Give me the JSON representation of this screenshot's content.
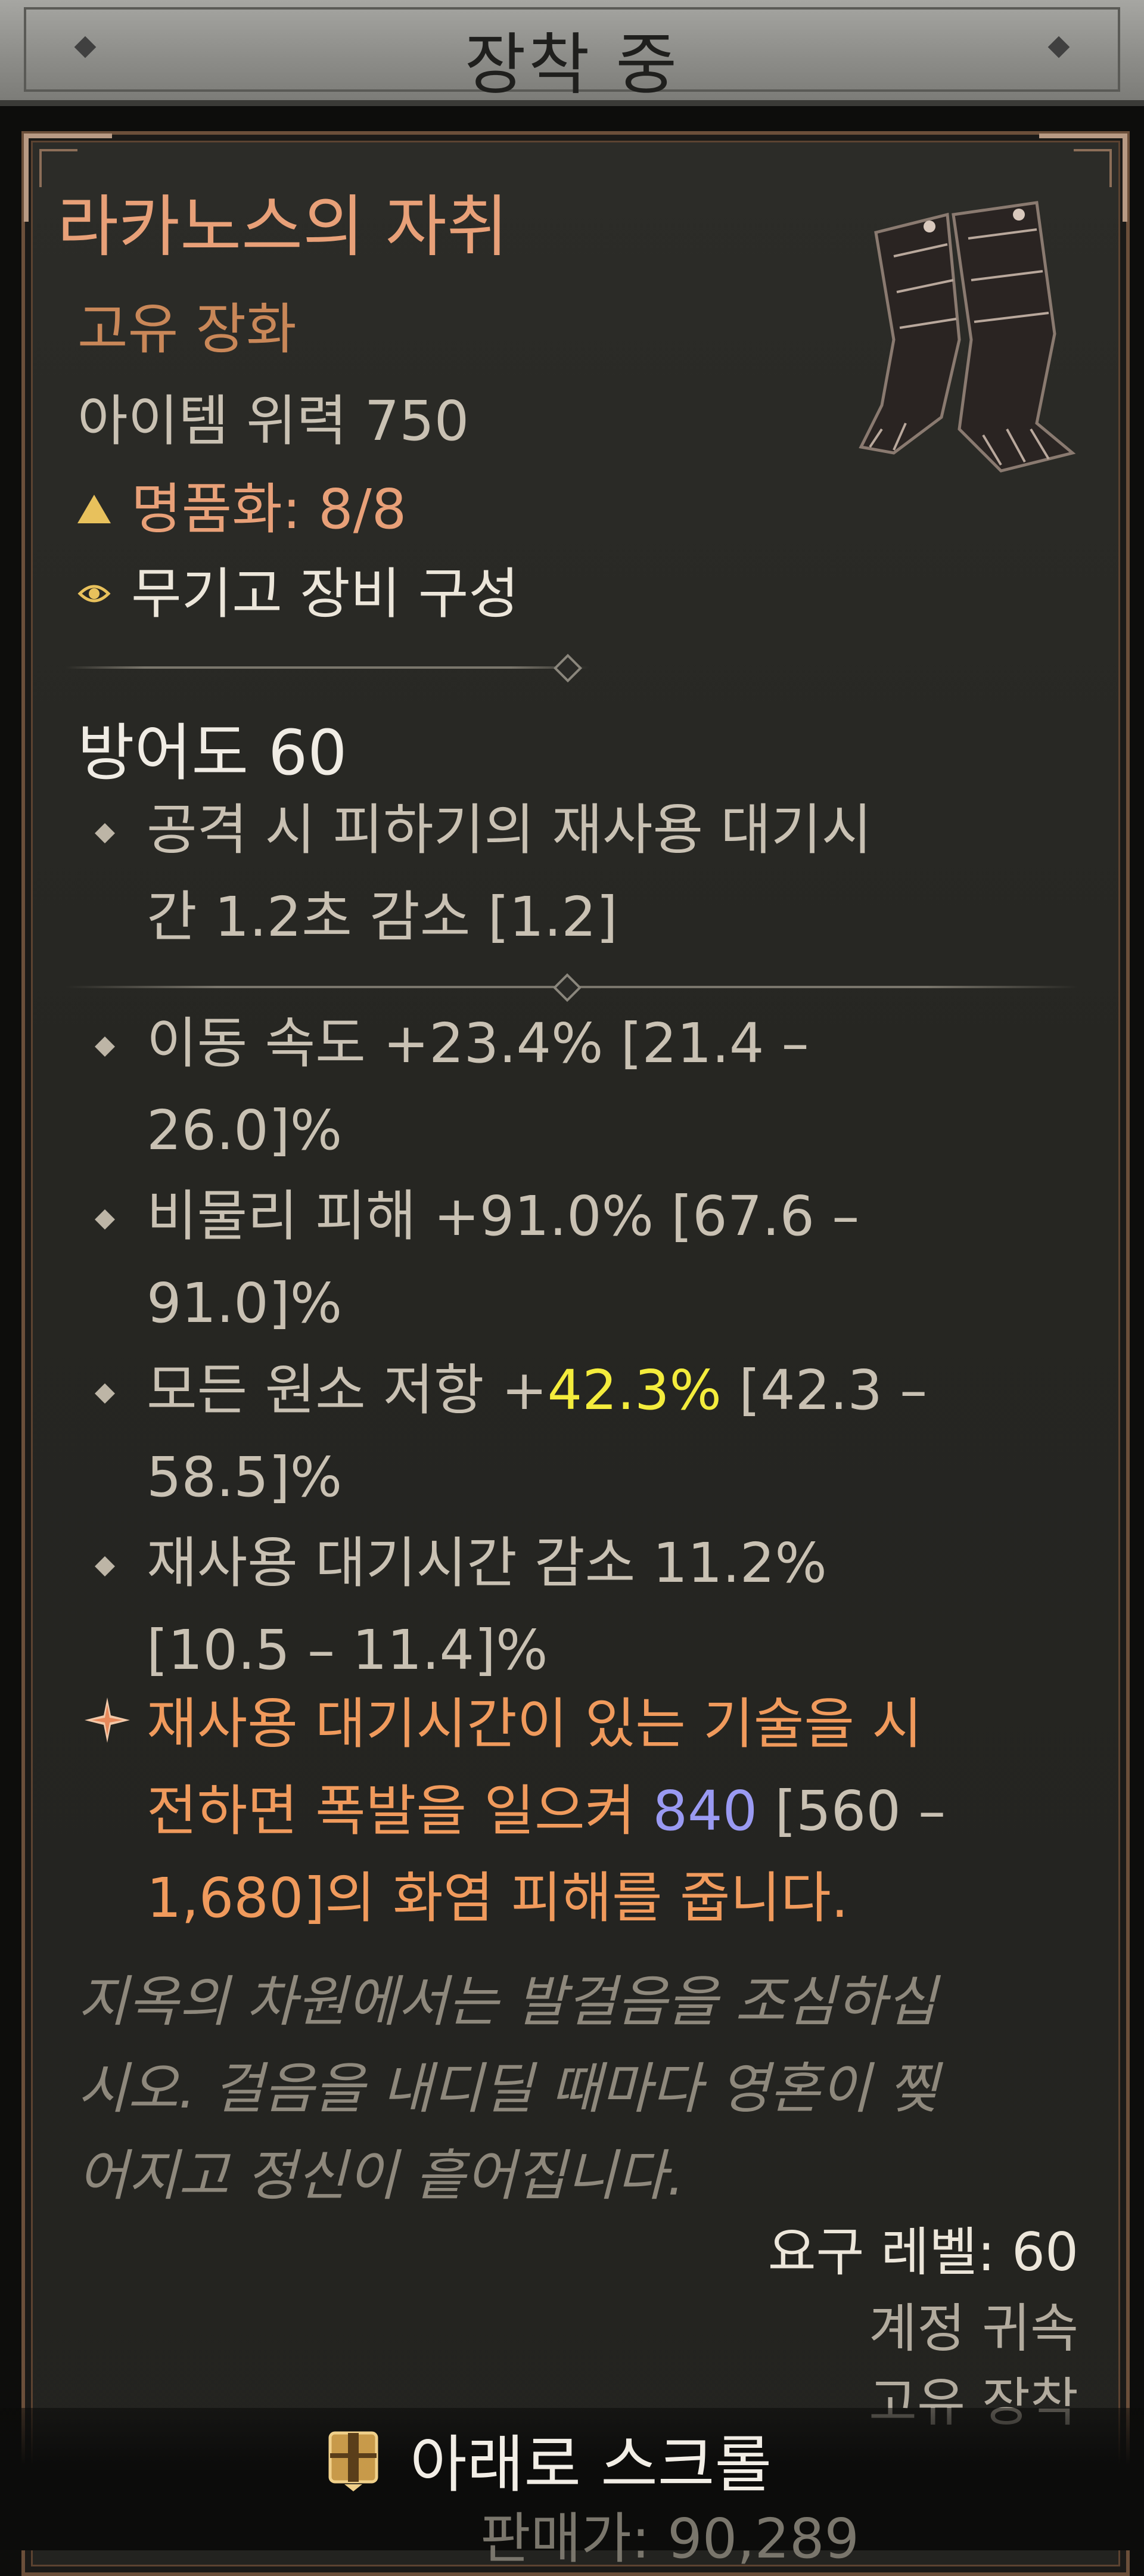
{
  "header": {
    "title": "장착 중"
  },
  "item": {
    "name": "라카노스의 자취",
    "type": "고유 장화",
    "power": "아이템 위력 750",
    "masterwork": "명품화: 8/8",
    "armory": "무기고 장비 구성"
  },
  "icons": {
    "masterwork": "triangle-icon",
    "armory": "eye-icon",
    "item_image": "boots-icon",
    "bullet": "diamond-bullet-icon",
    "unique_power": "star-icon",
    "scroll": "chest-icon"
  },
  "stats": {
    "armor": "방어도 60",
    "implicit": {
      "line1": "공격 시 피하기의 재사용 대기시",
      "line2": "간 1.2초 감소 [1.2]"
    },
    "affixes": [
      {
        "line1": "이동 속도 +23.4% [21.4 –",
        "line2": "26.0]%"
      },
      {
        "line1": "비물리 피해 +91.0% [67.6 –",
        "line2": "91.0]%"
      },
      {
        "pre": "모든 원소 저항 +",
        "highlight": "42.3%",
        "post": " [42.3 –",
        "line2": "58.5]%"
      },
      {
        "line1": "재사용 대기시간 감소 11.2%",
        "line2": "[10.5 – 11.4]%"
      }
    ],
    "unique_power": {
      "line1": "재사용 대기시간이 있는 기술을 시",
      "line2_pre": "전하면 폭발을 일으켜 ",
      "line2_value": "840",
      "line2_post": " [560 –",
      "line3": "1,680]의 화염 피해를 줍니다."
    }
  },
  "flavor": {
    "line1": "지옥의 차원에서는 발걸음을 조심하십",
    "line2": "시오. 걸음을 내디딜 때마다 영혼이 찢",
    "line3": "어지고 정신이 흩어집니다."
  },
  "requirements": {
    "level": "요구 레벨: 60",
    "bound": "계정 귀속",
    "equip": "고유 장착"
  },
  "footer": {
    "scroll_label": "아래로 스크롤",
    "price": "판매가: 90,289"
  },
  "colors": {
    "item_name": "#e8a078",
    "highlight_value": "#f4ec3c",
    "power_value": "#9a9af2",
    "unique_power": "#f09a5c"
  }
}
